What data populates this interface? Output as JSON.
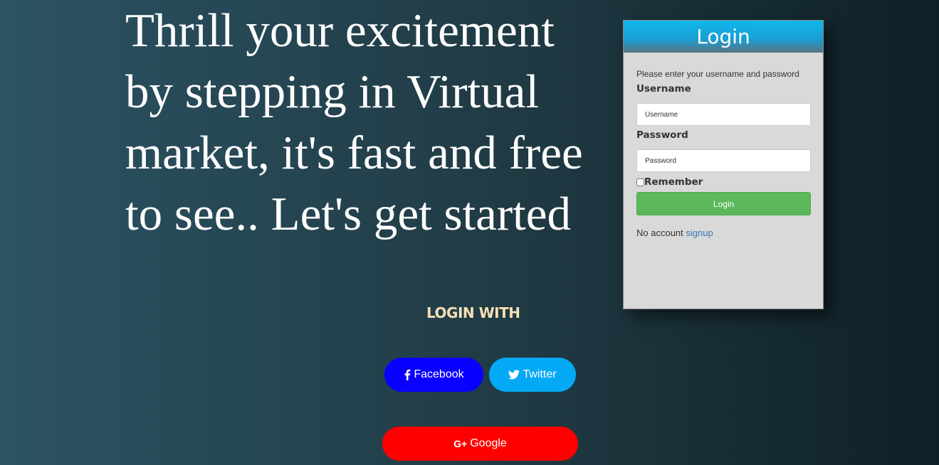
{
  "hero": {
    "headline": "Thrill your excitement by stepping in Virtual market, it's fast and free to see.. Let's get started"
  },
  "social": {
    "heading": "LOGIN WITH",
    "facebook_label": "Facebook",
    "twitter_label": "Twitter",
    "google_label": "Google",
    "google_icon_text": "G+",
    "facebook_color": "#0a00ff",
    "twitter_color": "#03a9f4",
    "google_color": "#ff0000"
  },
  "login_form": {
    "title": "Login",
    "instructions": "Please enter your username and password",
    "username_label": "Username",
    "username_placeholder": "Username",
    "username_value": "",
    "password_label": "Password",
    "password_placeholder": "Password",
    "password_value": "",
    "remember_label": "Remember",
    "remember_checked": false,
    "submit_label": "Login",
    "no_account_text": "No account",
    "signup_link": "signup",
    "submit_color": "#5cb85c",
    "header_color": "#0fb8ef"
  }
}
